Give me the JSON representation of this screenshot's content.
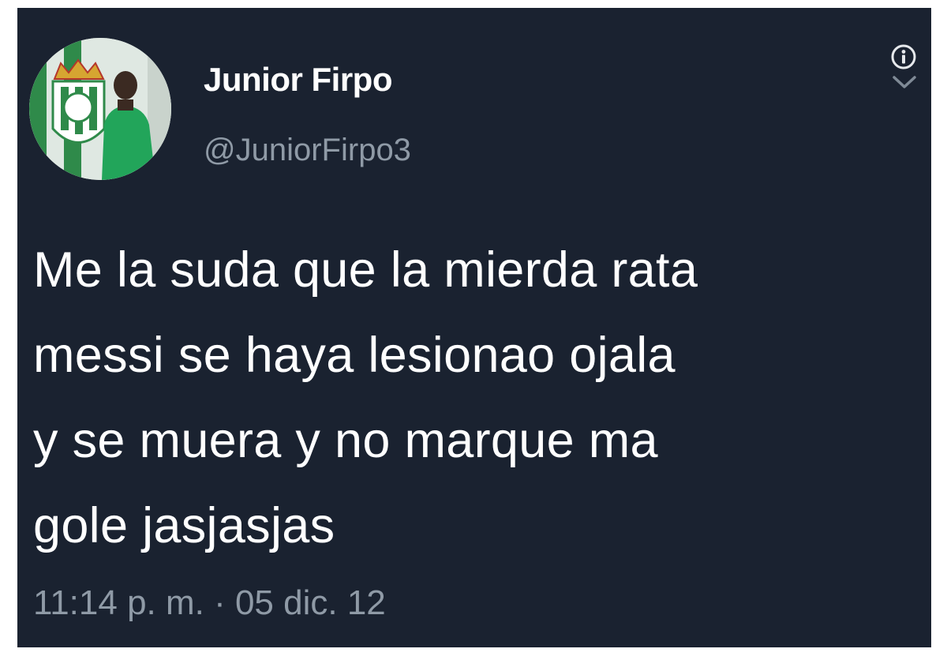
{
  "tweet": {
    "author": {
      "display_name": "Junior Firpo",
      "handle": "@JuniorFirpo3",
      "avatar_icon": "profile-photo"
    },
    "text": "Me la suda que la mierda rata\nmessi se haya lesionao ojala\ny se muera y no marque ma\ngole jasjasjas",
    "timestamp": "11:14 p. m. · 05 dic. 12",
    "icons": {
      "info": "info-icon",
      "menu": "chevron-down-icon"
    },
    "colors": {
      "background": "#1a2230",
      "text": "#ffffff",
      "secondary": "#8f9aa6"
    }
  }
}
